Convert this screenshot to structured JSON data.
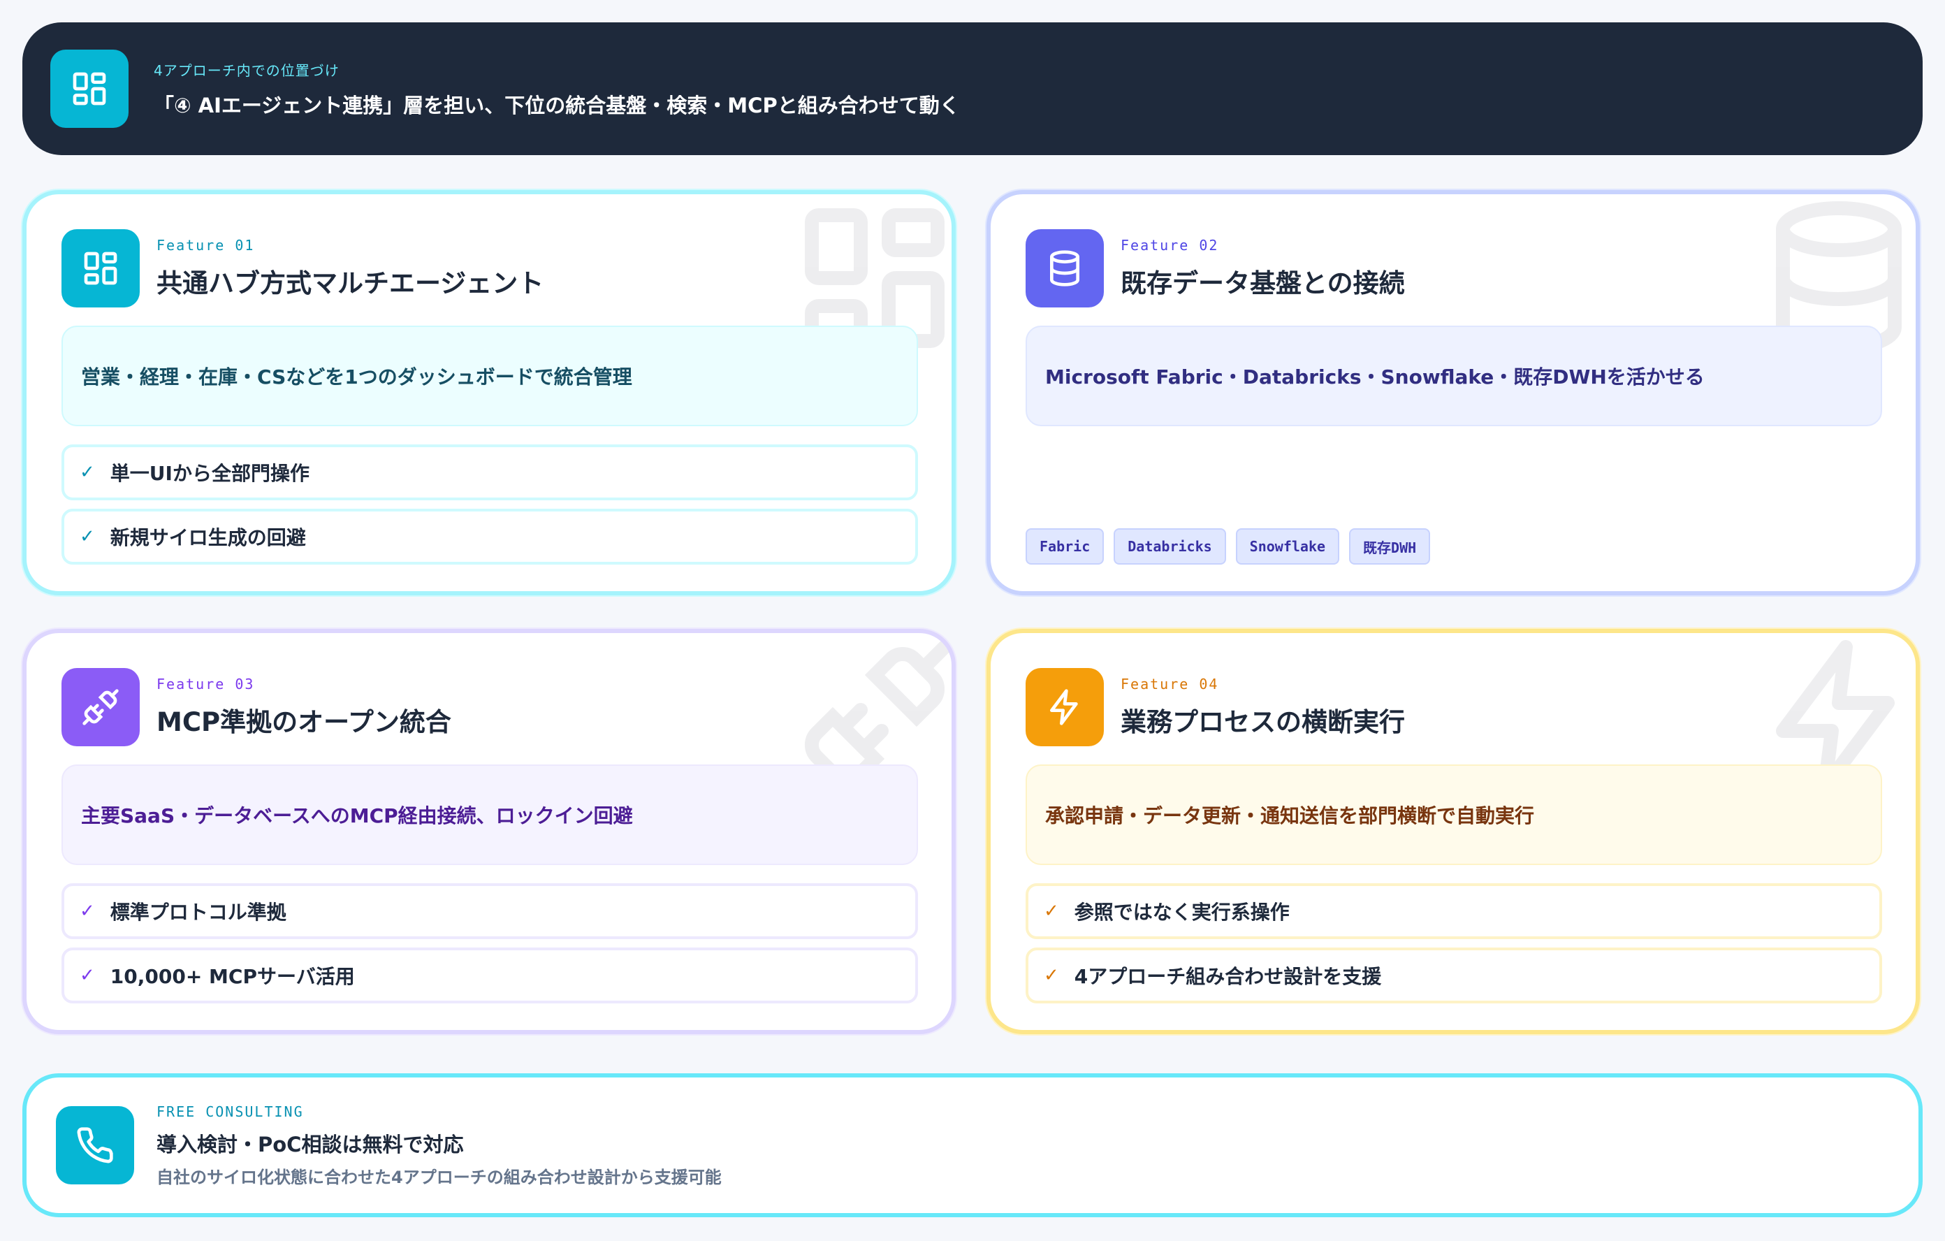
{
  "banner": {
    "icon": "dashboard-grid-icon",
    "eyebrow": "4アプローチ内での位置づけ",
    "title": "「④ AIエージェント連携」層を担い、下位の統合基盤・検索・MCPと組み合わせて動く"
  },
  "cards": [
    {
      "icon": "dashboard-grid-icon",
      "accent": "#06b6d4",
      "eyebrow": "Feature 01",
      "title": "共通ハブ方式マルチエージェント",
      "summary": "営業・経理・在庫・CSなどを1つのダッシュボードで統合管理",
      "checks": [
        "単一UIから全部門操作",
        "新規サイロ生成の回避"
      ]
    },
    {
      "icon": "database-icon",
      "accent": "#6366f1",
      "eyebrow": "Feature 02",
      "title": "既存データ基盤との接続",
      "summary": "Microsoft Fabric・Databricks・Snowflake・既存DWHを活かせる",
      "tags": [
        "Fabric",
        "Databricks",
        "Snowflake",
        "既存DWH"
      ]
    },
    {
      "icon": "plug-icon",
      "accent": "#8b5cf6",
      "eyebrow": "Feature 03",
      "title": "MCP準拠のオープン統合",
      "summary": "主要SaaS・データベースへのMCP経由接続、ロックイン回避",
      "checks": [
        "標準プロトコル準拠",
        "10,000+ MCPサーバ活用"
      ]
    },
    {
      "icon": "lightning-icon",
      "accent": "#f59e0b",
      "eyebrow": "Feature 04",
      "title": "業務プロセスの横断実行",
      "summary": "承認申請・データ更新・通知送信を部門横断で自動実行",
      "checks": [
        "参照ではなく実行系操作",
        "4アプローチ組み合わせ設計を支援"
      ]
    }
  ],
  "cta": {
    "icon": "phone-icon",
    "eyebrow": "FREE CONSULTING",
    "title": "導入検討・PoC相談は無料で対応",
    "subtitle": "自社のサイロ化状態に合わせた4アプローチの組み合わせ設計から支援可能"
  }
}
